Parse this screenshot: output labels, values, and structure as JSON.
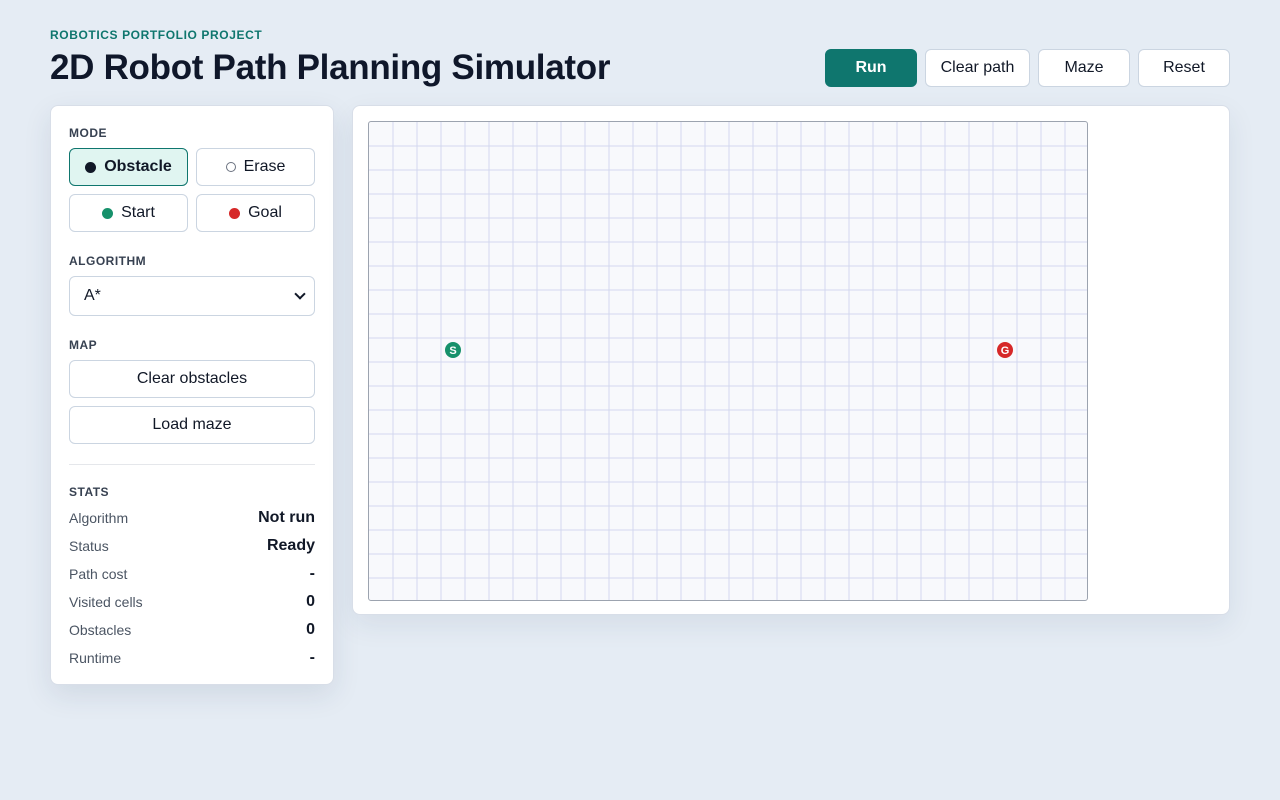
{
  "header": {
    "eyebrow": "ROBOTICS PORTFOLIO PROJECT",
    "title": "2D Robot Path Planning Simulator"
  },
  "toolbar": {
    "run_label": "Run",
    "clear_path_label": "Clear path",
    "maze_label": "Maze",
    "reset_label": "Reset"
  },
  "sidebar": {
    "mode": {
      "label": "MODE",
      "obstacle": "Obstacle",
      "erase": "Erase",
      "start": "Start",
      "goal": "Goal",
      "active": "Obstacle"
    },
    "algorithm": {
      "label": "ALGORITHM",
      "selected": "A*"
    },
    "map": {
      "label": "MAP",
      "clear_obstacles": "Clear obstacles",
      "load_maze": "Load maze"
    },
    "stats": {
      "label": "STATS",
      "algorithm_key": "Algorithm",
      "algorithm_val": "Not run",
      "status_key": "Status",
      "status_val": "Ready",
      "path_cost_key": "Path cost",
      "path_cost_val": "-",
      "visited_key": "Visited cells",
      "visited_val": "0",
      "obstacles_key": "Obstacles",
      "obstacles_val": "0",
      "runtime_key": "Runtime",
      "runtime_val": "-"
    }
  },
  "grid": {
    "cols": 30,
    "rows": 20,
    "start": {
      "label": "S",
      "col": 3,
      "row": 9
    },
    "goal": {
      "label": "G",
      "col": 26,
      "row": 9
    }
  },
  "colors": {
    "accent": "#0f766e",
    "start": "#16916b",
    "goal": "#d62828",
    "grid_line": "#d3d8ef",
    "cell_bg": "#f8f9fc"
  }
}
